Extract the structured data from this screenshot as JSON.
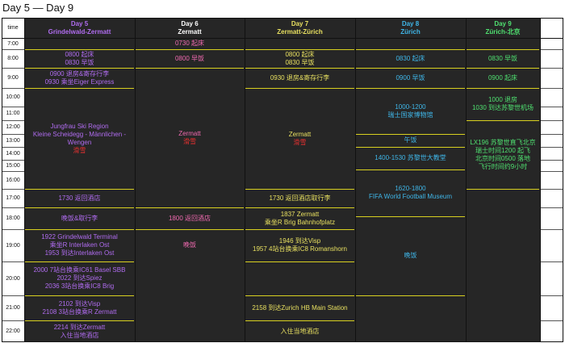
{
  "title": "Day 5 — Day 9",
  "colors": {
    "day5": "#b06cf0",
    "day6": "#ffffff",
    "day7": "#e8e060",
    "day8": "#3fb6e8",
    "day9": "#4fe070",
    "accent_red": "#e83030",
    "pink": "#f06ab0"
  },
  "header": {
    "time": "time",
    "day5": {
      "line1": "Day 5",
      "line2": "Grindelwald-Zermatt"
    },
    "day6": {
      "line1": "Day 6",
      "line2": "Zermatt"
    },
    "day7": {
      "line1": "Day 7",
      "line2": "Zermatt-Zürich"
    },
    "day8": {
      "line1": "Day 8",
      "line2": "Zürich"
    },
    "day9": {
      "line1": "Day 9",
      "line2": "Zürich-北京"
    }
  },
  "times": [
    "7:00",
    "8:00",
    "9:00",
    "10:00",
    "11:00",
    "12:00",
    "13:00",
    "14:00",
    "15:00",
    "16:00",
    "17:00",
    "18:00",
    "19:00",
    "20:00",
    "21:00",
    "22:00"
  ],
  "day5": {
    "e1": {
      "l1": "0800 起床",
      "l2": "0830 早饭"
    },
    "e2": {
      "l1": "0900 退房&寄存行李",
      "l2": "0930 乘坐Eiger Express"
    },
    "e3": {
      "l1": "Jungfrau Ski Region",
      "l2": "Kleine Scheidegg - Männlichen -",
      "l3": "Wengen",
      "l4": "滑雪"
    },
    "e4": "1730 返回酒店",
    "e5": "晚饭&取行李",
    "e6": {
      "l1": "1922 Grindelwald Terminal",
      "l2": "乘坐R Interlaken Ost",
      "l3": "1953 到达Interlaken Ost"
    },
    "e7": {
      "l1": "2000 7站台换乘IC61 Basel SBB",
      "l2": "2022 到达Spiez",
      "l3": "2036 3站台换乘IC8 Brig"
    },
    "e8": {
      "l1": "2102 到达Visp",
      "l2": "2108 3站台换乘R Zermatt"
    },
    "e9": {
      "l1": "2214 到达Zermatt",
      "l2": "入住当地酒店"
    }
  },
  "day6": {
    "e1": "0730 起床",
    "e2": "0800 早饭",
    "e3": {
      "l1": "Zermatt",
      "l2": "滑雪"
    },
    "e4": "1800 返回酒店",
    "e5": "晚饭"
  },
  "day7": {
    "e1": {
      "l1": "0800 起床",
      "l2": "0830 早饭"
    },
    "e2": "0930 退房&寄存行李",
    "e3": {
      "l1": "Zermatt",
      "l2": "滑雪"
    },
    "e4": "1730 返回酒店取行李",
    "e5": {
      "l1": "1837 Zermatt",
      "l2": "乘坐R Brig Bahnhofplatz"
    },
    "e6": {
      "l1": "1946 到达Visp",
      "l2": "1957 4站台换乘IC8 Romanshorn"
    },
    "e7": "2158 到达Zurich HB Main Station",
    "e8": "入住当地酒店"
  },
  "day8": {
    "e1": "0830 起床",
    "e2": "0900 早饭",
    "e3": {
      "l1": "1000-1200",
      "l2": "瑞士国家博物馆"
    },
    "e4": "午饭",
    "e5": "1400-1530 苏黎世大教堂",
    "e6": {
      "l1": "1620-1800",
      "l2": "FIFA World Football Museum"
    },
    "e7": "晚饭"
  },
  "day9": {
    "e1": "0830 早饭",
    "e2": "0900 起床",
    "e3": {
      "l1": "1000 退房",
      "l2": "1030 到达苏黎世机场"
    },
    "e4": {
      "l1": "LX196 苏黎世直飞北京",
      "l2": "瑞士时间1200 起飞",
      "l3": "北京时间0500 落地",
      "l4": "飞行时间约9小时"
    }
  }
}
